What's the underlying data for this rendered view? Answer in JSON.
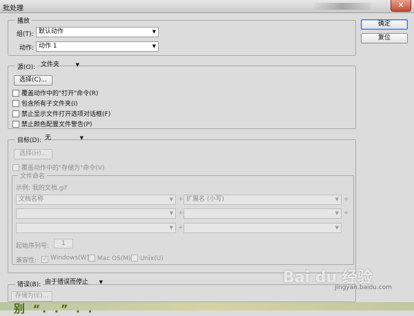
{
  "window": {
    "title": "批处理",
    "close_glyph": "✕"
  },
  "buttons": {
    "ok": "确定",
    "reset": "复位"
  },
  "playback": {
    "legend": "播放",
    "set_label": "组(T):",
    "set_value": "默认动作",
    "action_label": "动作:",
    "action_value": "动作 1"
  },
  "source": {
    "label": "源(O):",
    "value": "文件夹",
    "choose_button": "选择(C)...",
    "options": [
      {
        "label": "覆盖动作中的\"打开\"命令(R)",
        "checked": false
      },
      {
        "label": "包含所有子文件夹(I)",
        "checked": false
      },
      {
        "label": "禁止显示文件打开选项对话框(F)",
        "checked": false
      },
      {
        "label": "禁止颜色配置文件警告(P)",
        "checked": false
      }
    ]
  },
  "destination": {
    "label": "目标(D):",
    "value": "无",
    "choose_button": "选择(H)...",
    "override_save": "覆盖动作中的\"存储为\"命令(V)",
    "naming": {
      "legend": "文件命名",
      "example": "示例: 我的文档.gif",
      "field_1": "文档名称",
      "field_2": "扩展名 (小写)",
      "plus": "+",
      "serial_label": "起始序列号:",
      "serial_value": "1",
      "compat_label": "兼容性:",
      "compat": [
        {
          "label": "Windows(W)",
          "checked": true
        },
        {
          "label": "Mac OS(M)",
          "checked": false
        },
        {
          "label": "Unix(U)",
          "checked": false
        }
      ]
    }
  },
  "errors": {
    "label": "错误(B):",
    "value": "由于错误而停止",
    "save_as_button": "存储为(E)..."
  },
  "icons": {
    "dropdown": "▼",
    "check": "✓"
  },
  "watermark": {
    "brand": "Bai du 经验",
    "url": "jingyan.baidu.com"
  },
  "bottom_strip_text": "别 “.   .”    .    ."
}
